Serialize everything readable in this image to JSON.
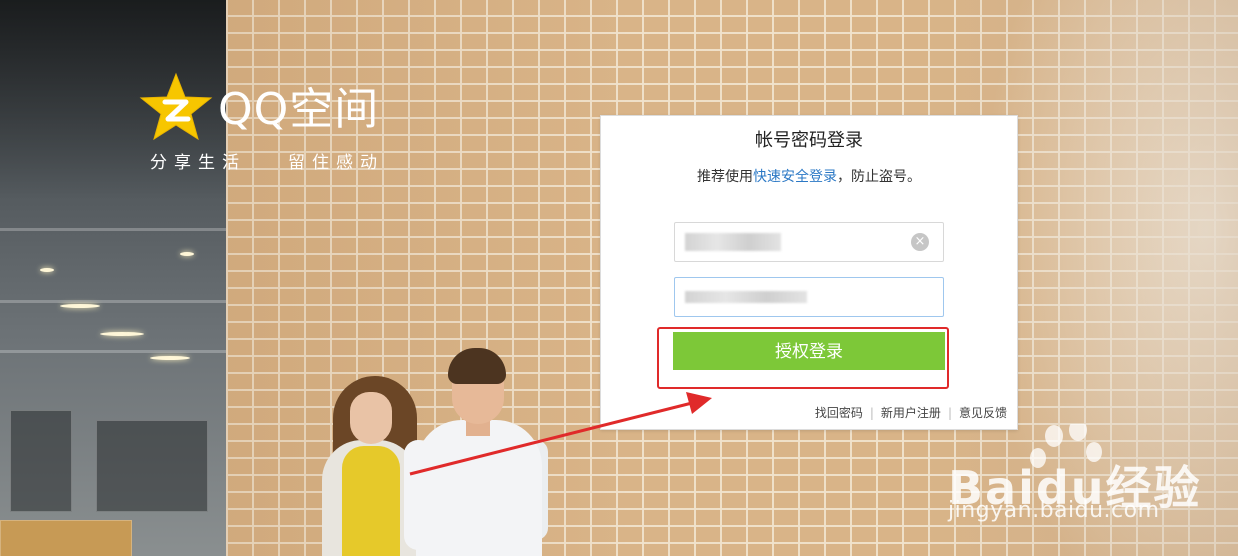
{
  "logo": {
    "brand": "QQ空间",
    "slogan_left": "分享生活",
    "slogan_right": "留住感动",
    "star_color": "#f7c600"
  },
  "login": {
    "title": "帐号密码登录",
    "tip_prefix": "推荐使用",
    "tip_link": "快速安全登录",
    "tip_suffix": "，防止盗号。",
    "clear_icon": "×",
    "submit_label": "授权登录",
    "links": [
      "找回密码",
      "新用户注册",
      "意见反馈"
    ],
    "accent_color": "#7dc838",
    "link_color": "#2b78c5"
  },
  "annotation": {
    "highlight_color": "#e02a2a"
  },
  "watermark": {
    "brand": "Baidu经验",
    "url": "jingyan.baidu.com"
  }
}
